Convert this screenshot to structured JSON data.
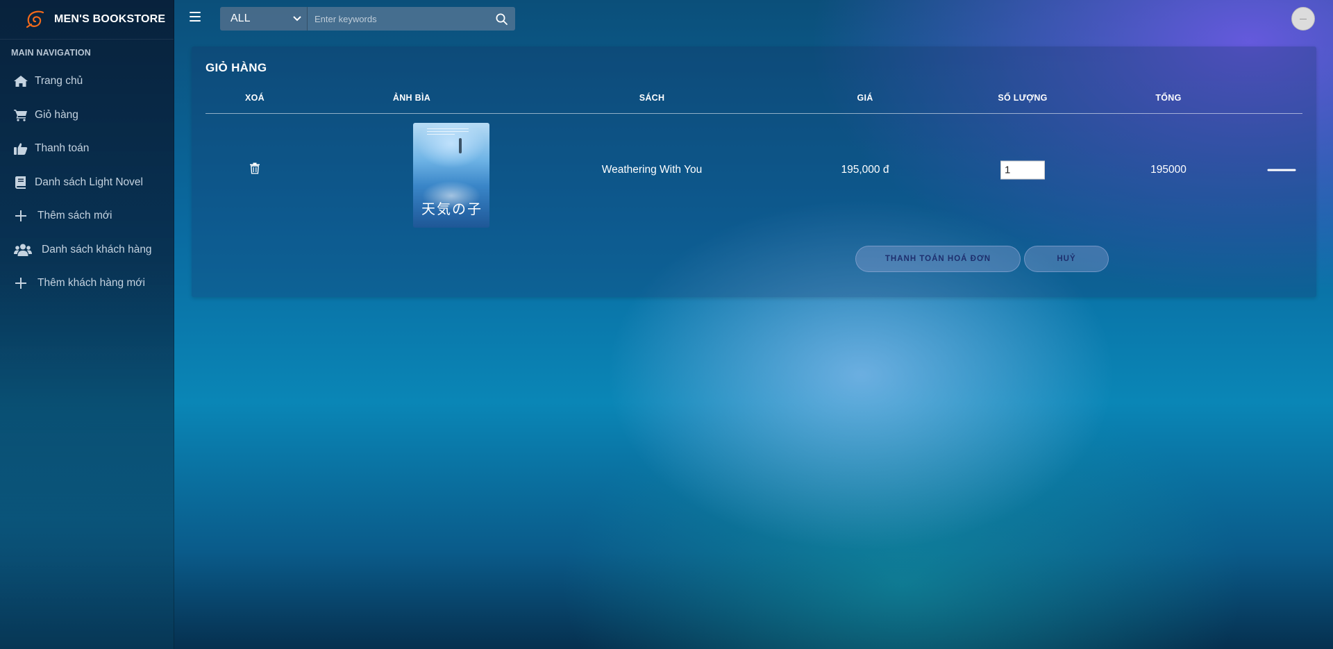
{
  "brand": {
    "name": "MEN'S BOOKSTORE"
  },
  "sidebar": {
    "header": "MAIN NAVIGATION",
    "items": [
      {
        "label": "Trang chủ",
        "icon": "home-icon"
      },
      {
        "label": "Giỏ hàng",
        "icon": "cart-icon"
      },
      {
        "label": "Thanh toán",
        "icon": "thumbs-up-icon"
      },
      {
        "label": "Danh sách Light Novel",
        "icon": "book-icon"
      },
      {
        "label": "Thêm sách mới",
        "icon": "plus-icon"
      },
      {
        "label": "Danh sách khách hàng",
        "icon": "users-icon"
      },
      {
        "label": "Thêm khách hàng mới",
        "icon": "plus-icon"
      }
    ]
  },
  "topbar": {
    "category": "ALL",
    "search_placeholder": "Enter keywords"
  },
  "cart": {
    "title": "GIỎ HÀNG",
    "columns": [
      "XOÁ",
      "ẢNH BÌA",
      "SÁCH",
      "GIÁ",
      "SỐ LƯỢNG",
      "TỔNG"
    ],
    "items": [
      {
        "book": "Weathering With You",
        "price": "195,000 đ",
        "quantity": "1",
        "total": "195000",
        "cover_text": "天気の子"
      }
    ],
    "checkout_label": "THANH TOÁN HOÁ ĐƠN",
    "cancel_label": "HUỶ"
  },
  "colors": {
    "sidebar_bg": "#0b2440",
    "button_text": "#1e2f6e",
    "accent_logo": "#f26a1b"
  }
}
